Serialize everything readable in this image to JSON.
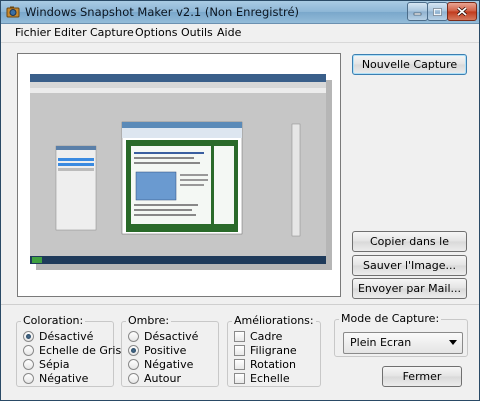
{
  "window": {
    "title": "Windows Snapshot Maker v2.1 (Non Enregistré)"
  },
  "menu": [
    "Fichier",
    "Editer",
    "Capture",
    "Options",
    "Outils",
    "Aide"
  ],
  "buttons": {
    "new_capture": "Nouvelle Capture",
    "copy_clipboard": "Copier dans le presse papier",
    "save_image": "Sauver l'Image...",
    "send_mail": "Envoyer par Mail...",
    "close": "Fermer"
  },
  "coloration": {
    "title": "Coloration:",
    "options": [
      {
        "label": "Désactivé",
        "selected": true
      },
      {
        "label": "Echelle de Gris",
        "selected": false
      },
      {
        "label": "Sépia",
        "selected": false
      },
      {
        "label": "Négative",
        "selected": false
      }
    ]
  },
  "ombre": {
    "title": "Ombre:",
    "options": [
      {
        "label": "Désactivé",
        "selected": false
      },
      {
        "label": "Positive",
        "selected": true
      },
      {
        "label": "Négative",
        "selected": false
      },
      {
        "label": "Autour",
        "selected": false
      }
    ]
  },
  "ameliorations": {
    "title": "Améliorations:",
    "options": [
      {
        "label": "Cadre",
        "checked": false
      },
      {
        "label": "Filigrane",
        "checked": false
      },
      {
        "label": "Rotation",
        "checked": false
      },
      {
        "label": "Echelle",
        "checked": false
      }
    ]
  },
  "capture_mode": {
    "title": "Mode de Capture:",
    "value": "Plein Ecran"
  },
  "colors": {
    "accent": "#3c7fb1",
    "preview_bg": "#e8e8e8",
    "photoshop_canvas": "#c8c8c8",
    "site_green": "#1e5a1e"
  }
}
